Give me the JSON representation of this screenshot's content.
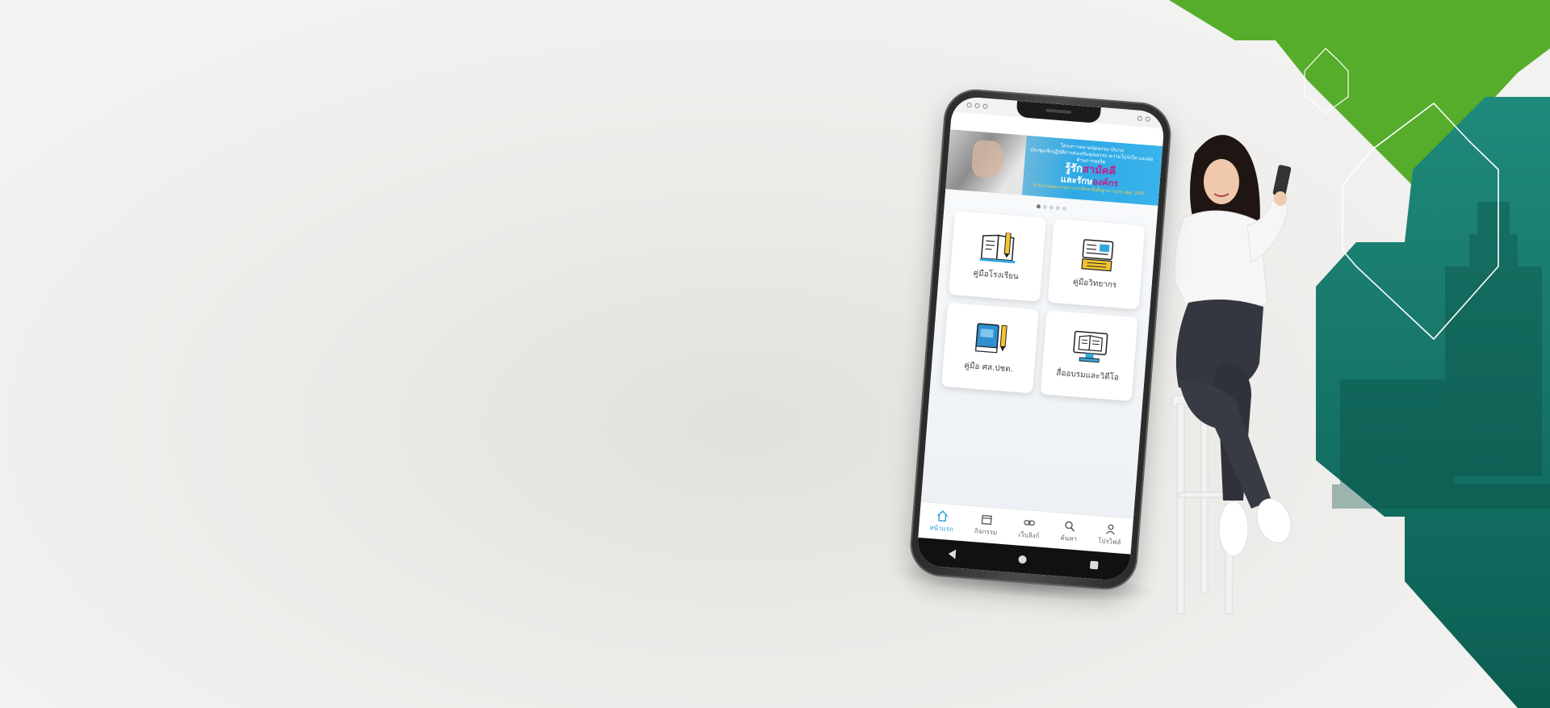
{
  "phone": {
    "status_bar": {
      "time": ""
    },
    "banner": {
      "line1": "โครงการตลาดนัดธรรมาภิบาล",
      "line2": "ประชุมเชิงปฏิบัติการส่งเสริมคุณธรรม ความโปร่งใส และต่อต้านการทุจริต",
      "headline_prefix": "รู้รัก",
      "headline_highlight": "สามัคคี",
      "subline_prefix": "และรักษ",
      "subline_highlight": "องค์กร",
      "footer": "สำนักงานคณะกรรมการการศึกษาขั้นพื้นฐาน ร่วมกับ สพฐ. 2565"
    },
    "carousel": {
      "pages": 5,
      "active_index": 0
    },
    "menu_cards": [
      {
        "label": "คู่มือโรงเรียน",
        "icon": "book-pencil-icon"
      },
      {
        "label": "คู่มือวิทยากร",
        "icon": "presentation-book-icon"
      },
      {
        "label": "คู่มือ ศส.ปชต.",
        "icon": "blue-book-pencil-icon"
      },
      {
        "label": "สื่ออบรมและวิดีโอ",
        "icon": "monitor-book-icon"
      }
    ],
    "bottom_nav": [
      {
        "label": "หน้าแรก",
        "icon": "home-icon",
        "active": true
      },
      {
        "label": "กิจกรรม",
        "icon": "calendar-icon",
        "active": false
      },
      {
        "label": "เว็บลิงก์",
        "icon": "link-icon",
        "active": false
      },
      {
        "label": "ค้นหา",
        "icon": "search-icon",
        "active": false
      },
      {
        "label": "โปรไฟล์",
        "icon": "profile-icon",
        "active": false
      }
    ]
  },
  "colors": {
    "accent_blue": "#2a9bd8",
    "brand_green": "#56ad2b",
    "brand_teal": "#14786a"
  }
}
